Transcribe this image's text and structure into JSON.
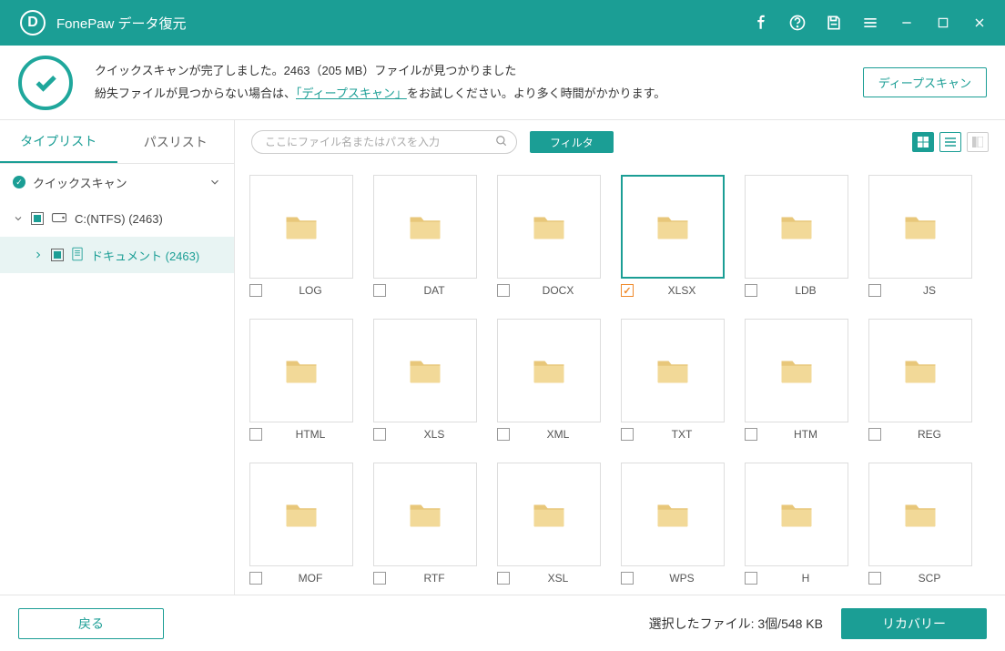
{
  "app": {
    "title": "FonePaw データ復元"
  },
  "status": {
    "line1": "クイックスキャンが完了しました。2463（205 MB）ファイルが見つかりました",
    "line2_before": "紛失ファイルが見つからない場合は、",
    "line2_link": "「ディープスキャン」",
    "line2_after": "をお試しください。より多く時間がかかります。",
    "deep_scan_btn": "ディープスキャン"
  },
  "sidebar": {
    "tabs": {
      "type": "タイプリスト",
      "path": "パスリスト"
    },
    "quick_scan": "クイックスキャン",
    "drive": "C:(NTFS) (2463)",
    "documents": "ドキュメント (2463)"
  },
  "toolbar": {
    "search_placeholder": "ここにファイル名またはパスを入力",
    "filter": "フィルタ"
  },
  "folders": [
    {
      "name": "LOG",
      "checked": false
    },
    {
      "name": "DAT",
      "checked": false
    },
    {
      "name": "DOCX",
      "checked": false
    },
    {
      "name": "XLSX",
      "checked": true
    },
    {
      "name": "LDB",
      "checked": false
    },
    {
      "name": "JS",
      "checked": false
    },
    {
      "name": "HTML",
      "checked": false
    },
    {
      "name": "XLS",
      "checked": false
    },
    {
      "name": "XML",
      "checked": false
    },
    {
      "name": "TXT",
      "checked": false
    },
    {
      "name": "HTM",
      "checked": false
    },
    {
      "name": "REG",
      "checked": false
    },
    {
      "name": "MOF",
      "checked": false
    },
    {
      "name": "RTF",
      "checked": false
    },
    {
      "name": "XSL",
      "checked": false
    },
    {
      "name": "WPS",
      "checked": false
    },
    {
      "name": "H",
      "checked": false
    },
    {
      "name": "SCP",
      "checked": false
    }
  ],
  "footer": {
    "back": "戻る",
    "selection": "選択したファイル: 3個/548 KB",
    "recover": "リカバリー"
  }
}
